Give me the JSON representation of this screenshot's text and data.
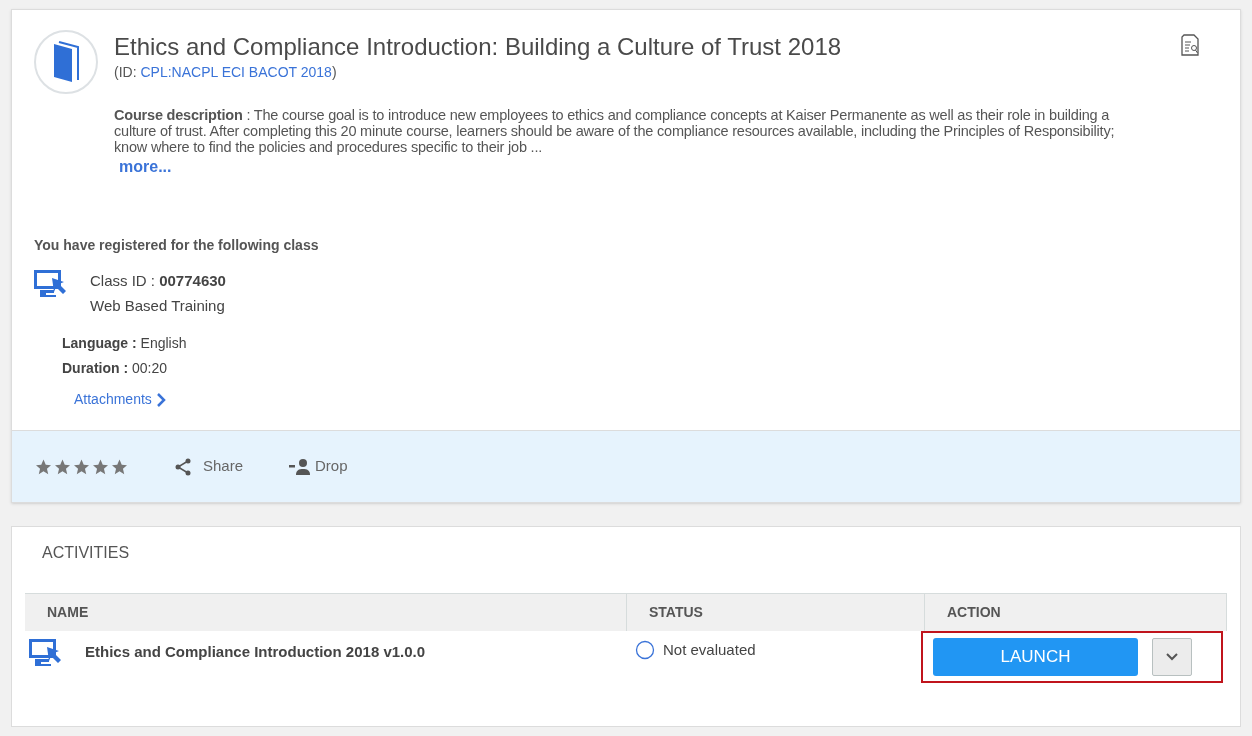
{
  "course": {
    "title": "Ethics and Compliance Introduction: Building a Culture of Trust 2018",
    "id_prefix": "(ID: ",
    "id": "CPL:NACPL ECI BACOT 2018",
    "id_suffix": ")",
    "description": "**Course description** : The course goal is to introduce new employees to ethics and compliance concepts at Kaiser Permanente as well as their role in building a culture of trust. After completing this 20 minute course, learners should be aware of the compliance resources available, including the Principles of Responsibility; know where to find the policies and procedures specific to their job ...",
    "more": "more..."
  },
  "registration": {
    "heading": "You have registered for the following class",
    "class_id_label": "Class ID : ",
    "class_id": "00774630",
    "class_type": "Web Based Training",
    "language_label": "Language : ",
    "language": "English",
    "duration_label": "Duration : ",
    "duration": "00:20",
    "attachments": "Attachments"
  },
  "footer": {
    "stars": 5,
    "share": "Share",
    "drop": "Drop"
  },
  "activities": {
    "heading": "ACTIVITIES",
    "columns": [
      "NAME",
      "STATUS",
      "ACTION"
    ],
    "rows": [
      {
        "name": "Ethics and Compliance Introduction 2018 v1.0.0",
        "status": "Not evaluated",
        "action": "LAUNCH",
        "highlighted": true
      }
    ]
  }
}
